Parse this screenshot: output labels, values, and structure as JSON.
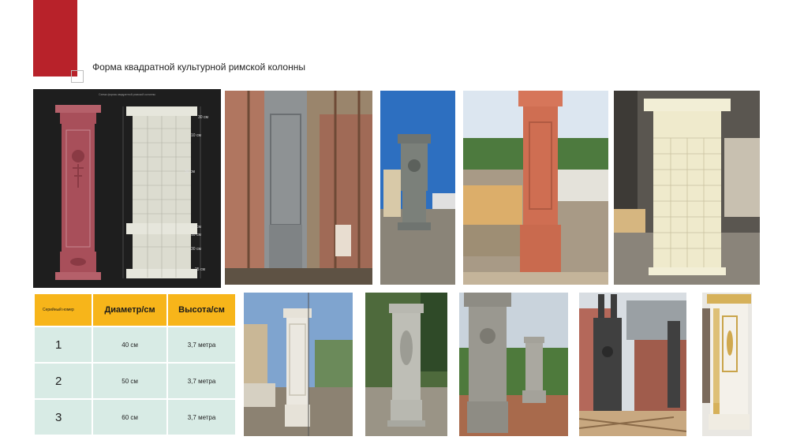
{
  "title": "Форма квадратной культурной римской колонны",
  "table": {
    "headers": [
      "Серийный номер",
      "Диаметр/см",
      "Высота/см"
    ],
    "rows": [
      {
        "no": "1",
        "diameter": "40 см",
        "height": "3,7 метра"
      },
      {
        "no": "2",
        "diameter": "50 см",
        "height": "3,7 метра"
      },
      {
        "no": "3",
        "diameter": "60 см",
        "height": "3,7 метра"
      }
    ]
  },
  "diagram": {
    "header": "Схема формы квадратной римской колонны",
    "dims": [
      "30 см",
      "10 см",
      "30 см",
      "10 см",
      "10 см",
      "30 см",
      "25 см"
    ]
  },
  "colors": {
    "accent": "#b8222a",
    "table_header": "#f7b51a",
    "table_cell": "#d8ebe5"
  }
}
